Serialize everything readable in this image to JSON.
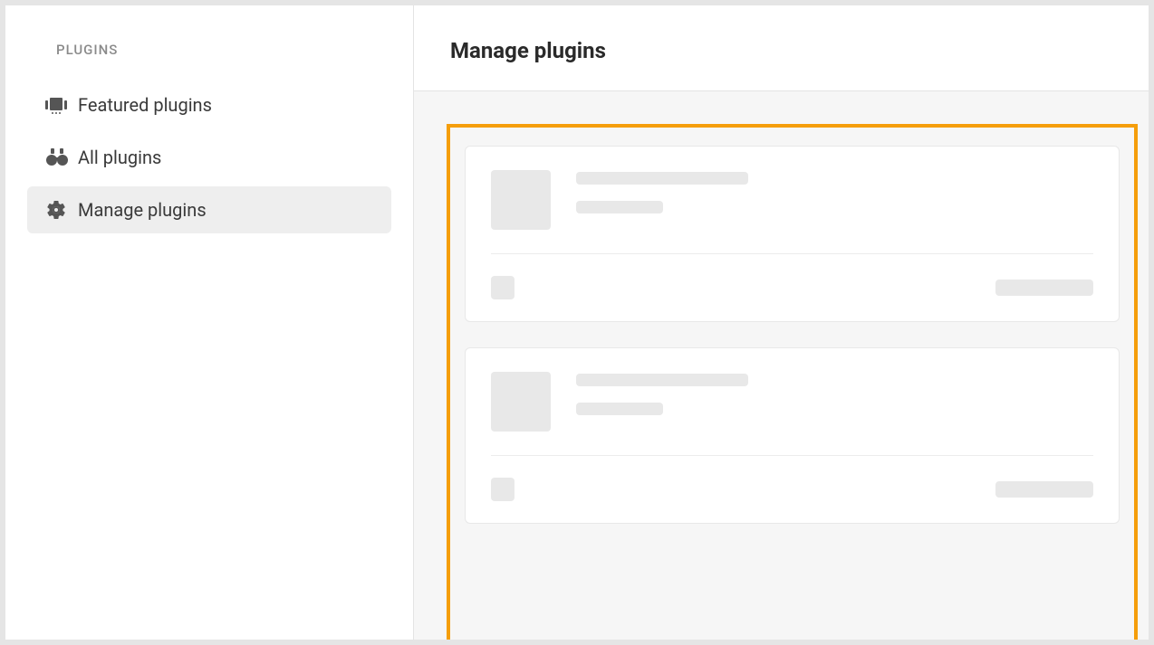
{
  "sidebar": {
    "heading": "PLUGINS",
    "items": [
      {
        "label": "Featured plugins",
        "icon": "featured",
        "active": false
      },
      {
        "label": "All plugins",
        "icon": "binoculars",
        "active": false
      },
      {
        "label": "Manage plugins",
        "icon": "gear",
        "active": true
      }
    ]
  },
  "main": {
    "title": "Manage plugins"
  },
  "colors": {
    "highlight": "#f59e0b",
    "skeleton": "#e8e8e8",
    "pageBg": "#f6f6f6"
  }
}
